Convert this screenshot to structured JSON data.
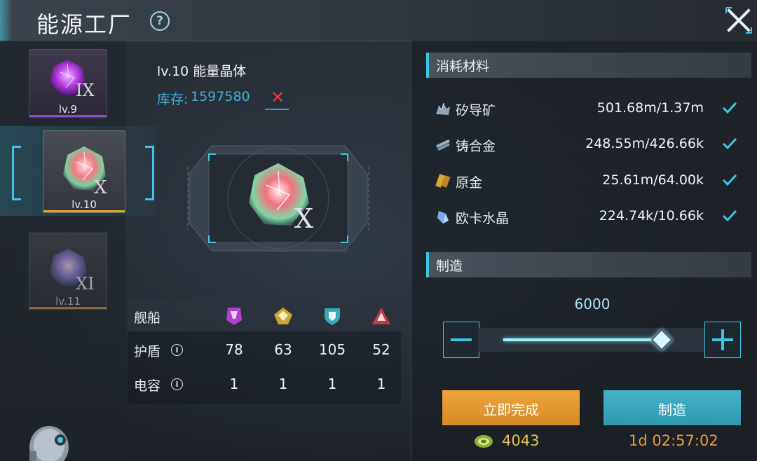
{
  "header": {
    "title": "能源工厂",
    "help_icon": "question-circle-icon",
    "close_icon": "close-x-icon"
  },
  "crystals": [
    {
      "level": "lv.9",
      "numeral": "IX",
      "color": "#b03ae0",
      "selected": false
    },
    {
      "level": "lv.10",
      "numeral": "X",
      "color": "#f07a82",
      "selected": true
    },
    {
      "level": "lv.11",
      "numeral": "XI",
      "color": "#8a78c8",
      "selected": false
    }
  ],
  "item": {
    "name": "lv.10 能量晶体",
    "stock_label": "库存:",
    "stock_value": "1597580",
    "showcase_numeral": "X"
  },
  "stats": {
    "ship_label": "舰船",
    "ship_icons": [
      "purple-ship-icon",
      "gold-ship-icon",
      "blue-shield-ship-icon",
      "red-ship-icon"
    ],
    "rows": [
      {
        "label": "护盾",
        "values": [
          "78",
          "63",
          "105",
          "52"
        ]
      },
      {
        "label": "电容",
        "values": [
          "1",
          "1",
          "1",
          "1"
        ]
      }
    ]
  },
  "materials": {
    "heading": "消耗材料",
    "items": [
      {
        "name": "矽导矿",
        "amount": "501.68m/1.37m",
        "icon": "ore-icon"
      },
      {
        "name": "铸合金",
        "amount": "248.55m/426.66k",
        "icon": "alloy-icon"
      },
      {
        "name": "原金",
        "amount": "25.61m/64.00k",
        "icon": "gold-bar-icon"
      },
      {
        "name": "欧卡水晶",
        "amount": "224.74k/10.66k",
        "icon": "crystal-icon"
      }
    ]
  },
  "manufacture": {
    "heading": "制造",
    "quantity": "6000",
    "slider_fraction": 0.86,
    "instant_label": "立即完成",
    "build_label": "制造",
    "cost": "4043",
    "timer": "1d 02:57:02"
  },
  "colors": {
    "accent": "#3cc6e3",
    "instant": "#e89a33",
    "build": "#3aa7bd",
    "stock": "#3fb1d6",
    "timer": "#e8983a"
  }
}
